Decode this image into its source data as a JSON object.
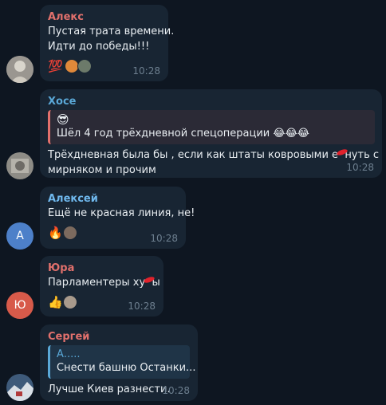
{
  "colors": {
    "background": "#0e1621",
    "bubble": "#182533",
    "name_alex": "#e1706c",
    "name_hose": "#5aa8d7",
    "name_alexey": "#6fb8ed",
    "name_yura": "#e1706c",
    "name_sergey": "#e1706c",
    "quote_hose": "#e1706c",
    "quote_sergey": "#5aa8d7",
    "avatar_alexey": "#4d80c9",
    "avatar_yura": "#d75a4a"
  },
  "messages": [
    {
      "sender": "Алекс",
      "lines": [
        "Пустая трата времени.",
        "Идти до победы!!!"
      ],
      "reactions": [
        "💯"
      ],
      "time": "10:28"
    },
    {
      "sender": "Хосе",
      "quote_emoji": "😎",
      "quote_text": "Шёл 4 год трёхдневной спецоперации 😂😂😂",
      "line1_part1": "Трёхдневная была бы , если как штаты ковровыми е",
      "line1_part2": "нуть с",
      "line2": "мирняком и прочим",
      "time": "10:28"
    },
    {
      "sender": "Алексей",
      "avatar_letter": "А",
      "line": "Ещё не красная линия, не!",
      "reactions": [
        "🔥"
      ],
      "time": "10:28"
    },
    {
      "sender": "Юра",
      "avatar_letter": "Ю",
      "line_part1": "Парламентеры ху",
      "line_part2": "ы",
      "reactions": [
        "👍"
      ],
      "time": "10:28"
    },
    {
      "sender": "Сергей",
      "quote_author": "А.....",
      "quote_text": "Снести башню Останки...",
      "line": "Лучше Киев разнести.",
      "time": "10:28"
    }
  ]
}
